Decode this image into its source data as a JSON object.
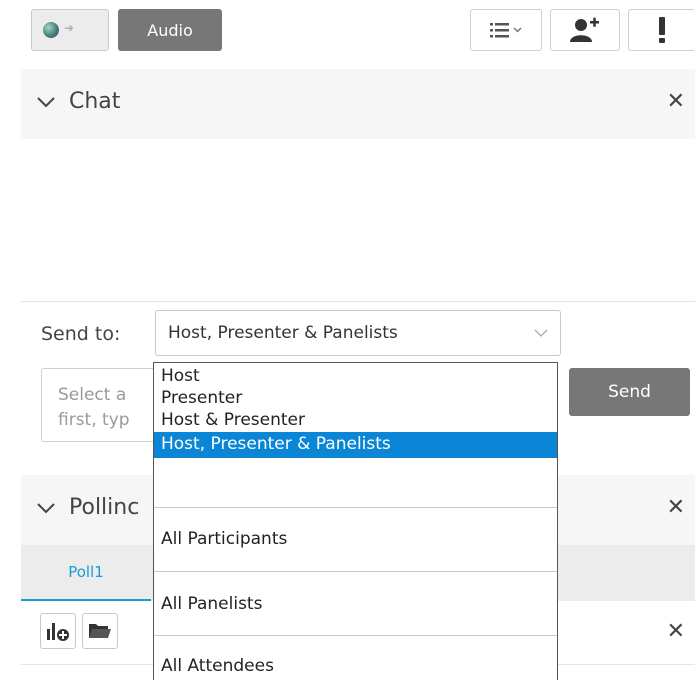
{
  "toolbar": {
    "audio_label": "Audio",
    "status_icon": "connection-status-icon",
    "list_icon": "list-view-icon",
    "add_user_icon": "add-user-icon",
    "alert_icon": "exclamation-icon"
  },
  "chat": {
    "title": "Chat",
    "send_to_label": "Send to:",
    "send_to_value": "Host, Presenter & Panelists",
    "message_placeholder_line1": "Select a",
    "message_placeholder_line2": "first, typ",
    "send_label": "Send",
    "close_symbol": "✕"
  },
  "dropdown": {
    "options": [
      "Host",
      "Presenter",
      "Host & Presenter",
      "Host, Presenter & Panelists",
      "All Participants",
      "All Panelists",
      "All Attendees"
    ],
    "selected": "Host, Presenter & Panelists"
  },
  "polling": {
    "title": "Pollinc",
    "tab_label": "Poll1",
    "close_symbol": "✕",
    "toolbar_close_symbol": "✕"
  },
  "colors": {
    "accent": "#0b86d6",
    "button_gray": "#777777",
    "tab_blue": "#1a9bd8"
  }
}
